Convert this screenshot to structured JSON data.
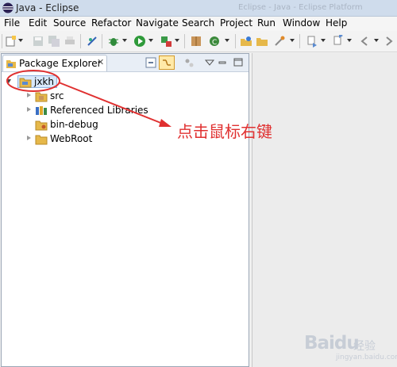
{
  "window": {
    "title": "Java - Eclipse",
    "ghost_title": "Eclipse - Java - Eclipse Platform"
  },
  "menu": [
    "File",
    "Edit",
    "Source",
    "Refactor",
    "Navigate",
    "Search",
    "Project",
    "Run",
    "Window",
    "Help"
  ],
  "panel": {
    "tab_label": "Package Explorer",
    "close_glyph": "✕"
  },
  "tree": [
    {
      "label": "jxkh",
      "icon": "java-project-icon",
      "expanded": true,
      "selected": true
    },
    {
      "label": "src",
      "icon": "package-folder-icon",
      "expanded": false
    },
    {
      "label": "Referenced Libraries",
      "icon": "libraries-icon",
      "expanded": false
    },
    {
      "label": "bin-debug",
      "icon": "folder-icon",
      "expanded": false
    },
    {
      "label": "WebRoot",
      "icon": "folder-icon",
      "expanded": false
    }
  ],
  "annotation": {
    "text": "点击鼠标右键",
    "color": "#e03030"
  },
  "watermark": {
    "brand": "Baidu",
    "suffix": "经验",
    "url": "jingyan.baidu.com"
  }
}
